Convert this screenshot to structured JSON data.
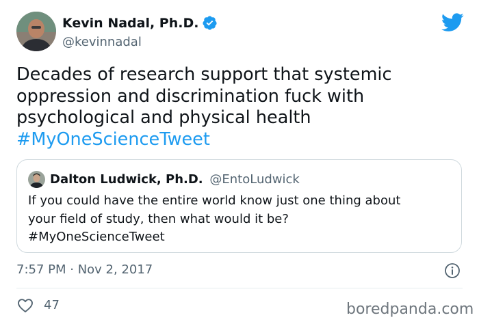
{
  "author": {
    "name": "Kevin Nadal, Ph.D.",
    "handle": "@kevinnadal",
    "verified": true
  },
  "tweet": {
    "lines": [
      "Decades of research support that systemic",
      "oppression and discrimination fuck with",
      "psychological and physical health"
    ],
    "hashtag": "#MyOneScienceTweet"
  },
  "quoted_tweet": {
    "name": "Dalton Ludwick, Ph.D.",
    "handle": "@EntoLudwick",
    "lines": [
      "If you could have the entire world know just one thing about",
      "your field of study, then what would it be?",
      "#MyOneScienceTweet"
    ]
  },
  "meta": {
    "timestamp": "7:57 PM · Nov 2, 2017",
    "likes": "47"
  },
  "watermark": "boredpanda.com",
  "colors": {
    "accent": "#1d9bf0",
    "text": "#0f1419",
    "muted": "#536471",
    "border": "#cfd9de"
  },
  "icons": [
    "verified-badge-icon",
    "twitter-bird-icon",
    "info-icon",
    "heart-icon"
  ]
}
